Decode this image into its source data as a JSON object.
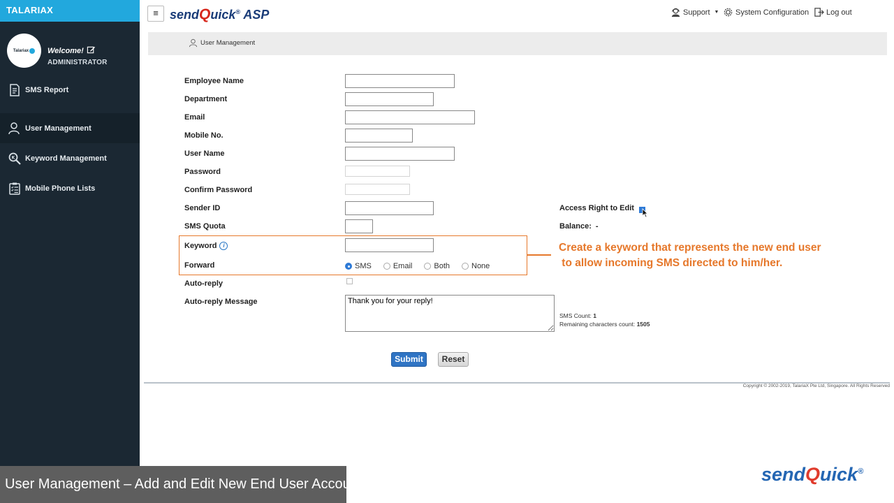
{
  "sidebar": {
    "brand": "TALARIAX",
    "avatar_text": "Talariax",
    "welcome": "Welcome!",
    "user_role": "ADMINISTRATOR",
    "items": [
      {
        "label": "SMS Report",
        "icon": "report-icon",
        "active": false
      },
      {
        "label": "User Management",
        "icon": "user-icon",
        "active": true
      },
      {
        "label": "Keyword Management",
        "icon": "keyword-search-icon",
        "active": false
      },
      {
        "label": "Mobile Phone Lists",
        "icon": "checklist-icon",
        "active": false
      }
    ]
  },
  "topbar": {
    "menu_icon": "≡",
    "logo_pre": "send",
    "logo_q": "Q",
    "logo_post": "uick",
    "logo_reg": "®",
    "logo_suffix": " ASP",
    "support": "Support",
    "system_config": "System Configuration",
    "logout": "Log out"
  },
  "breadcrumb": {
    "label": "User Management"
  },
  "form": {
    "employee_name": {
      "label": "Employee Name",
      "value": ""
    },
    "department": {
      "label": "Department",
      "value": ""
    },
    "email": {
      "label": "Email",
      "value": ""
    },
    "mobile_no": {
      "label": "Mobile No.",
      "value": ""
    },
    "user_name": {
      "label": "User Name",
      "value": ""
    },
    "password": {
      "label": "Password",
      "value": ""
    },
    "confirm_password": {
      "label": "Confirm Password",
      "value": ""
    },
    "sender_id": {
      "label": "Sender ID",
      "value": ""
    },
    "sms_quota": {
      "label": "SMS Quota",
      "value": ""
    },
    "keyword": {
      "label": "Keyword",
      "value": ""
    },
    "forward": {
      "label": "Forward",
      "options": [
        "SMS",
        "Email",
        "Both",
        "None"
      ],
      "selected": "SMS"
    },
    "auto_reply": {
      "label": "Auto-reply",
      "checked": false
    },
    "auto_reply_message": {
      "label": "Auto-reply Message",
      "value": "Thank you for your reply!"
    },
    "access_right": {
      "label": "Access Right to Edit",
      "checked": true
    },
    "balance": {
      "label": "Balance:",
      "value": "-"
    },
    "sms_count": {
      "label": "SMS Count:",
      "value": "1"
    },
    "remaining": {
      "label": "Remaining characters count:",
      "value": "1505"
    },
    "submit_label": "Submit",
    "reset_label": "Reset"
  },
  "callout": "Create a keyword that represents the new end user\n to allow incoming SMS directed to him/her.",
  "footer": {
    "copyright": "Copyright © 2002-2019, TalariaX Pte Ltd, Singapore. All Rights Reserved"
  },
  "caption": {
    "title": "User Management – Add and Edit New End User Account",
    "logo_pre": "send",
    "logo_q": "Q",
    "logo_post": "uick",
    "logo_reg": "®"
  },
  "colors": {
    "accent": "#22a8dd",
    "sidebar": "#1b2833",
    "highlight": "#e6782b",
    "submit": "#2f74c4"
  }
}
